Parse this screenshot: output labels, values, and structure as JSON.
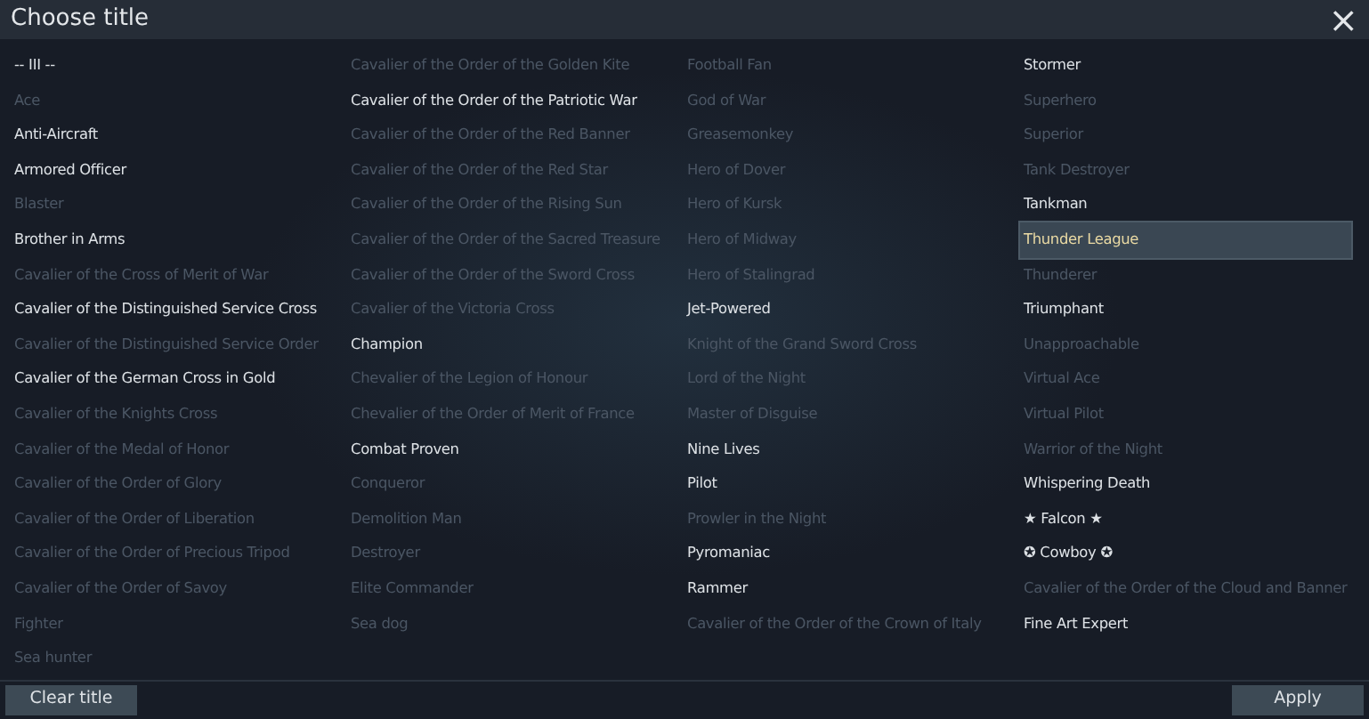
{
  "window": {
    "title": "Choose title",
    "close": "×"
  },
  "columns": [
    [
      {
        "label": "-- III --",
        "disabled": false,
        "selected": false
      },
      {
        "label": "Ace",
        "disabled": true,
        "selected": false
      },
      {
        "label": "Anti-Aircraft",
        "disabled": false,
        "selected": false
      },
      {
        "label": "Armored Officer",
        "disabled": false,
        "selected": false
      },
      {
        "label": "Blaster",
        "disabled": true,
        "selected": false
      },
      {
        "label": "Brother in Arms",
        "disabled": false,
        "selected": false
      },
      {
        "label": "Cavalier of the Cross of Merit of War",
        "disabled": true,
        "selected": false
      },
      {
        "label": "Cavalier of the Distinguished Service Cross",
        "disabled": false,
        "selected": false
      },
      {
        "label": "Cavalier of the Distinguished Service Order",
        "disabled": true,
        "selected": false
      },
      {
        "label": "Cavalier of the German Cross in Gold",
        "disabled": false,
        "selected": false
      },
      {
        "label": "Cavalier of the Knights Cross",
        "disabled": true,
        "selected": false
      },
      {
        "label": "Cavalier of the Medal of Honor",
        "disabled": true,
        "selected": false
      },
      {
        "label": "Cavalier of the Order of Glory",
        "disabled": true,
        "selected": false
      },
      {
        "label": "Cavalier of the Order of Liberation",
        "disabled": true,
        "selected": false
      },
      {
        "label": "Cavalier of the Order of Precious Tripod",
        "disabled": true,
        "selected": false
      },
      {
        "label": "Cavalier of the Order of Savoy",
        "disabled": true,
        "selected": false
      },
      {
        "label": "Fighter",
        "disabled": true,
        "selected": false
      },
      {
        "label": "Sea hunter",
        "disabled": true,
        "selected": false
      }
    ],
    [
      {
        "label": "Cavalier of the Order of the Golden Kite",
        "disabled": true,
        "selected": false
      },
      {
        "label": "Cavalier of the Order of the Patriotic War",
        "disabled": false,
        "selected": false
      },
      {
        "label": "Cavalier of the Order of the Red Banner",
        "disabled": true,
        "selected": false
      },
      {
        "label": "Cavalier of the Order of the Red Star",
        "disabled": true,
        "selected": false
      },
      {
        "label": "Cavalier of the Order of the Rising Sun",
        "disabled": true,
        "selected": false
      },
      {
        "label": "Cavalier of the Order of the Sacred Treasure",
        "disabled": true,
        "selected": false
      },
      {
        "label": "Cavalier of the Order of the Sword Cross",
        "disabled": true,
        "selected": false
      },
      {
        "label": "Cavalier of the Victoria Cross",
        "disabled": true,
        "selected": false
      },
      {
        "label": "Champion",
        "disabled": false,
        "selected": false
      },
      {
        "label": "Chevalier of the Legion of Honour",
        "disabled": true,
        "selected": false
      },
      {
        "label": "Chevalier of the Order of Merit of France",
        "disabled": true,
        "selected": false
      },
      {
        "label": "Combat Proven",
        "disabled": false,
        "selected": false
      },
      {
        "label": "Conqueror",
        "disabled": true,
        "selected": false
      },
      {
        "label": "Demolition Man",
        "disabled": true,
        "selected": false
      },
      {
        "label": "Destroyer",
        "disabled": true,
        "selected": false
      },
      {
        "label": "Elite Commander",
        "disabled": true,
        "selected": false
      },
      {
        "label": "Sea dog",
        "disabled": true,
        "selected": false
      }
    ],
    [
      {
        "label": "Football Fan",
        "disabled": true,
        "selected": false
      },
      {
        "label": "God of War",
        "disabled": true,
        "selected": false
      },
      {
        "label": "Greasemonkey",
        "disabled": true,
        "selected": false
      },
      {
        "label": "Hero of Dover",
        "disabled": true,
        "selected": false
      },
      {
        "label": "Hero of Kursk",
        "disabled": true,
        "selected": false
      },
      {
        "label": "Hero of Midway",
        "disabled": true,
        "selected": false
      },
      {
        "label": "Hero of Stalingrad",
        "disabled": true,
        "selected": false
      },
      {
        "label": "Jet-Powered",
        "disabled": false,
        "selected": false
      },
      {
        "label": "Knight of the Grand Sword Cross",
        "disabled": true,
        "selected": false
      },
      {
        "label": "Lord of the Night",
        "disabled": true,
        "selected": false
      },
      {
        "label": "Master of Disguise",
        "disabled": true,
        "selected": false
      },
      {
        "label": "Nine Lives",
        "disabled": false,
        "selected": false
      },
      {
        "label": "Pilot",
        "disabled": false,
        "selected": false
      },
      {
        "label": "Prowler in the Night",
        "disabled": true,
        "selected": false
      },
      {
        "label": "Pyromaniac",
        "disabled": false,
        "selected": false
      },
      {
        "label": "Rammer",
        "disabled": false,
        "selected": false
      },
      {
        "label": "Cavalier of the Order of the Crown of Italy",
        "disabled": true,
        "selected": false
      }
    ],
    [
      {
        "label": "Stormer",
        "disabled": false,
        "selected": false
      },
      {
        "label": "Superhero",
        "disabled": true,
        "selected": false
      },
      {
        "label": "Superior",
        "disabled": true,
        "selected": false
      },
      {
        "label": "Tank Destroyer",
        "disabled": true,
        "selected": false
      },
      {
        "label": "Tankman",
        "disabled": false,
        "selected": false
      },
      {
        "label": "Thunder League",
        "disabled": false,
        "selected": true
      },
      {
        "label": "Thunderer",
        "disabled": true,
        "selected": false
      },
      {
        "label": "Triumphant",
        "disabled": false,
        "selected": false
      },
      {
        "label": "Unapproachable",
        "disabled": true,
        "selected": false
      },
      {
        "label": "Virtual Ace",
        "disabled": true,
        "selected": false
      },
      {
        "label": "Virtual Pilot",
        "disabled": true,
        "selected": false
      },
      {
        "label": "Warrior of the Night",
        "disabled": true,
        "selected": false
      },
      {
        "label": "Whispering Death",
        "disabled": false,
        "selected": false
      },
      {
        "label": "★ Falcon ★",
        "disabled": false,
        "selected": false
      },
      {
        "label": "✪ Cowboy ✪",
        "disabled": false,
        "selected": false
      },
      {
        "label": "Cavalier of the Order of the Cloud and Banner",
        "disabled": true,
        "selected": false
      },
      {
        "label": "Fine Art Expert",
        "disabled": false,
        "selected": false
      }
    ]
  ],
  "footer": {
    "clear": "Clear title",
    "apply": "Apply"
  }
}
